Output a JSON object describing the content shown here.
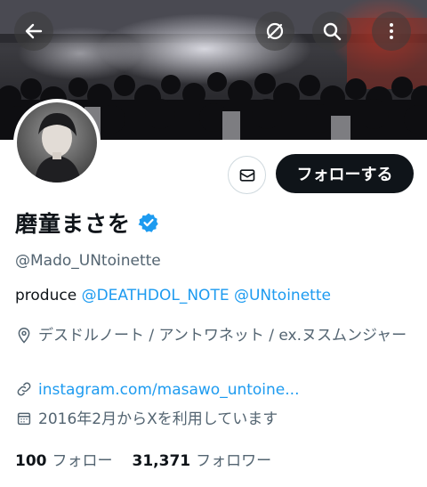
{
  "header": {
    "back_icon": "arrow-left-icon",
    "hide_icon": "eye-slash-icon",
    "search_icon": "search-icon",
    "more_icon": "more-vertical-icon"
  },
  "profile": {
    "display_name": "磨童まさを",
    "verified": true,
    "handle": "@Mado_UNtoinette",
    "bio_prefix": "produce",
    "bio_mentions": [
      "@DEATHDOL_NOTE",
      "@UNtoinette"
    ],
    "location": "デスドルノート / アントワネット / ex.ヌスムンジャー",
    "website": "instagram.com/masawo_untoine...",
    "joined": "2016年2月からXを利用しています",
    "following_count": "100",
    "following_label": "フォロー",
    "followers_count": "31,371",
    "followers_label": "フォロワー"
  },
  "actions": {
    "message_icon": "mail-icon",
    "follow_label": "フォローする"
  },
  "colors": {
    "accent": "#1d9bf0",
    "text": "#0f1419",
    "secondary": "#536471",
    "button_dark": "#0f1419"
  }
}
